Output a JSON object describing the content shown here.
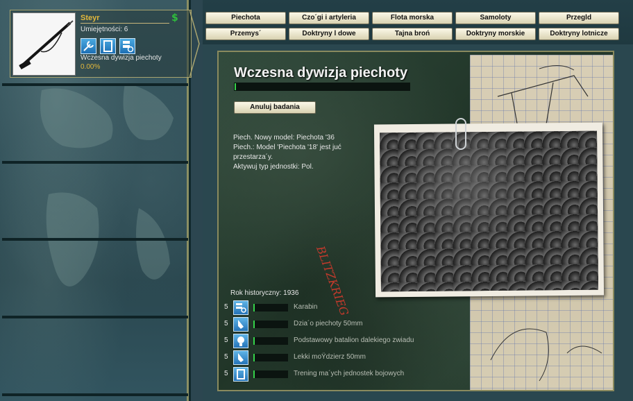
{
  "selected_tech": {
    "name": "Steyr",
    "skill": "Umiejętności: 6",
    "project_name": "Wczesna dywizja piechoty",
    "progress": "0.00%",
    "icons": [
      "wrench-icon",
      "book-icon",
      "database-icon"
    ]
  },
  "tabs": {
    "row1": [
      "Piechota",
      "Czo´gi i artyleria",
      "Flota morska",
      "Samoloty",
      "Przegld"
    ],
    "row2": [
      "Przemys´",
      "Doktryny l dowe",
      "Tajna broń",
      "Doktryny morskie",
      "Doktryny lotnicze"
    ]
  },
  "project": {
    "title": "Wczesna dywizja piechoty",
    "progress_fraction": 0.0,
    "cancel_label": "Anuluj badania",
    "effects": [
      "Piech. Nowy model: Piechota '36",
      "Piech.: Model 'Piechota '18' jest juć",
      "przestarza´y.",
      "Aktywuj typ jednostki: Pol."
    ],
    "historical_year": "Rok historyczny: 1936",
    "components": [
      {
        "num": "5",
        "label": "Karabin",
        "icon": "database-icon",
        "progress_fraction": 0.0
      },
      {
        "num": "5",
        "label": "Dzia´o piechoty 50mm",
        "icon": "flask-icon",
        "progress_fraction": 0.0
      },
      {
        "num": "5",
        "label": "Podstawowy batalion dalekiego zwiadu",
        "icon": "lightbulb-icon",
        "progress_fraction": 0.0
      },
      {
        "num": "5",
        "label": "Lekki moŸdzierz 50mm",
        "icon": "flask-icon",
        "progress_fraction": 0.0
      },
      {
        "num": "5",
        "label": "Trening ma´ych jednostek bojowych",
        "icon": "book-icon",
        "progress_fraction": 0.0
      }
    ],
    "scribble_text": "BLITZKRIEG"
  },
  "colors": {
    "accent_gold": "#e3b83b",
    "progress_green": "#35d34a",
    "tab_bg": "#f4f0dc",
    "panel_green": "#2a4233"
  }
}
